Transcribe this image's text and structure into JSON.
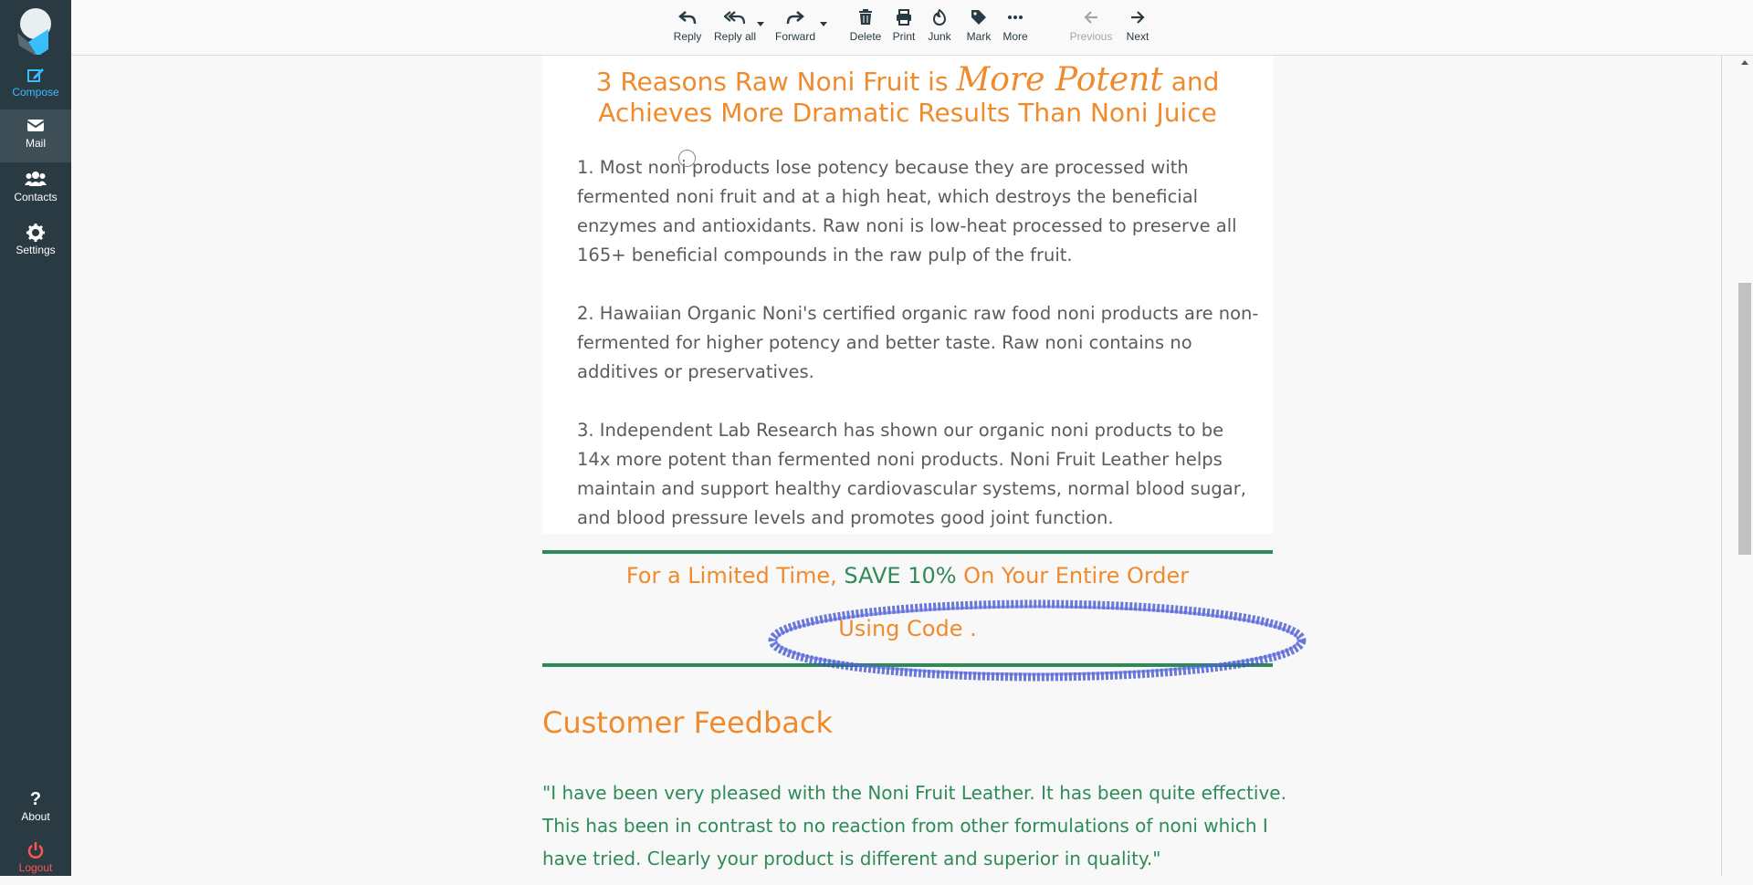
{
  "sidebar": {
    "items": [
      {
        "label": "Compose",
        "icon": "compose-icon"
      },
      {
        "label": "Mail",
        "icon": "mail-icon"
      },
      {
        "label": "Contacts",
        "icon": "contacts-icon"
      },
      {
        "label": "Settings",
        "icon": "settings-icon"
      }
    ],
    "about": "About",
    "logout": "Logout"
  },
  "toolbar": {
    "reply": "Reply",
    "reply_all": "Reply all",
    "forward": "Forward",
    "delete": "Delete",
    "print": "Print",
    "junk": "Junk",
    "mark": "Mark",
    "more": "More",
    "previous": "Previous",
    "next": "Next"
  },
  "email": {
    "headline_part1": "3 Reasons Raw Noni Fruit is ",
    "headline_script": "More Potent",
    "headline_part2": " and Achieves More Dramatic Results Than Noni Juice",
    "paragraphs": [
      "1. Most noni products lose potency because they are processed with fermented noni fruit and at a high heat, which destroys the beneficial enzymes and antioxidants. Raw noni is low-heat processed to preserve all 165+ beneficial compounds in the raw pulp of the fruit.",
      "2. Hawaiian Organic Noni's certified organic raw food noni products are non-fermented for higher potency and better taste. Raw noni contains no additives or preservatives.",
      "3. Independent Lab Research has shown our organic noni products to be 14x more potent than fermented noni products. Noni Fruit Leather helps maintain and support healthy cardiovascular systems, normal blood sugar, and blood pressure levels and promotes good joint function."
    ],
    "promo_part1": "For a Limited Time, ",
    "promo_highlight": "SAVE 10%",
    "promo_part2": " On Your Entire Order",
    "promo_code": "Using Code .",
    "feedback_title": "Customer Feedback",
    "feedback_quote": "\"I have been very pleased with the Noni Fruit Leather. It has been quite effective. This has been in contrast to no reaction from other formulations of noni which I have tried. Clearly your product is different and superior in quality.\""
  },
  "colors": {
    "sidebar_bg": "#2a3a42",
    "accent_blue": "#37beff",
    "orange": "#ef8a2d",
    "green": "#2e8b57",
    "logout_red": "#ff5552"
  }
}
